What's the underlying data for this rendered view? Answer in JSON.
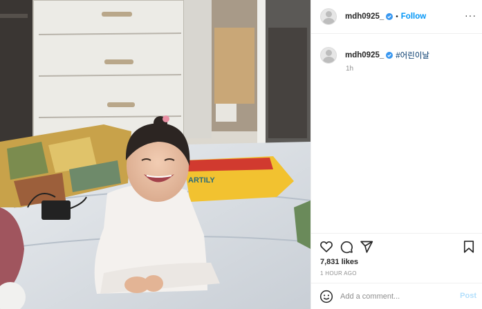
{
  "post": {
    "photo_icon": "photo-of-toddler-on-bed"
  },
  "header": {
    "username": "mdh0925_",
    "dot": "•",
    "follow_label": "Follow",
    "more_icon": "ellipsis-icon",
    "more_glyph": "···"
  },
  "caption": {
    "username": "mdh0925_",
    "hashtag": "#어린이날",
    "time": "1h"
  },
  "actions": {
    "like_icon": "heart-icon",
    "comment_icon": "comment-icon",
    "share_icon": "paper-plane-icon",
    "save_icon": "bookmark-icon",
    "likes": "7,831 likes",
    "ago": "1 HOUR AGO"
  },
  "comment": {
    "placeholder": "Add a comment...",
    "post_label": "Post",
    "emoji_icon": "smiley-icon"
  },
  "colors": {
    "accent": "#0095f6",
    "verified": "#3897f0",
    "hashtag": "#00376b",
    "muted": "#8e8e8e",
    "post_disabled": "#b2dffc"
  }
}
